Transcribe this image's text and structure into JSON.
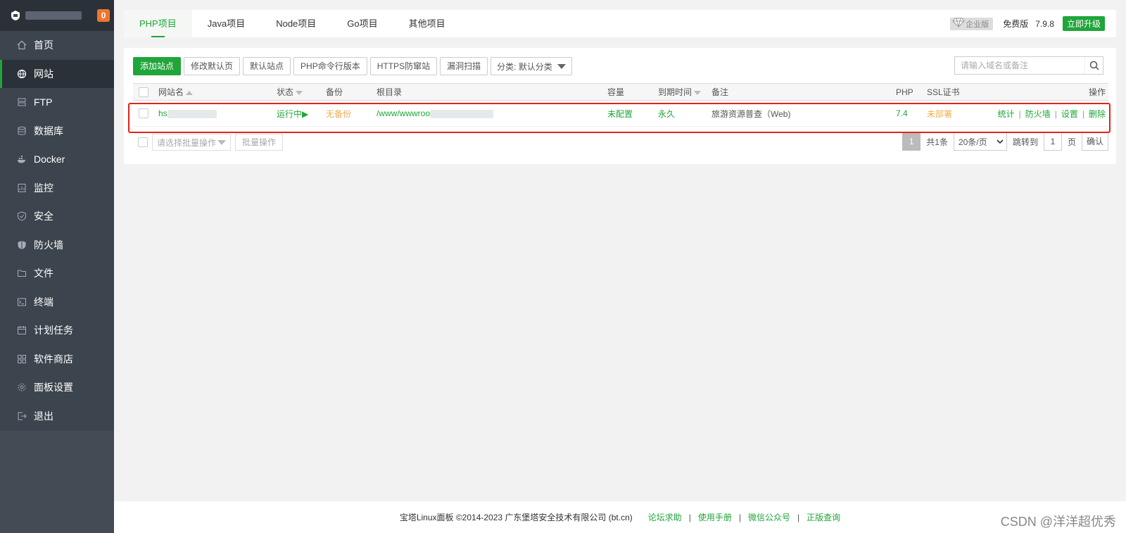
{
  "sidebar": {
    "badge": "0",
    "items": [
      {
        "label": "首页",
        "icon": "home-icon"
      },
      {
        "label": "网站",
        "icon": "globe-icon"
      },
      {
        "label": "FTP",
        "icon": "ftp-icon"
      },
      {
        "label": "数据库",
        "icon": "database-icon"
      },
      {
        "label": "Docker",
        "icon": "docker-icon"
      },
      {
        "label": "监控",
        "icon": "monitor-icon"
      },
      {
        "label": "安全",
        "icon": "shield-icon"
      },
      {
        "label": "防火墙",
        "icon": "firewall-icon"
      },
      {
        "label": "文件",
        "icon": "folder-icon"
      },
      {
        "label": "终端",
        "icon": "terminal-icon"
      },
      {
        "label": "计划任务",
        "icon": "calendar-icon"
      },
      {
        "label": "软件商店",
        "icon": "apps-icon"
      },
      {
        "label": "面板设置",
        "icon": "gear-icon"
      },
      {
        "label": "退出",
        "icon": "logout-icon"
      }
    ],
    "active_index": 1
  },
  "tabs": [
    "PHP项目",
    "Java项目",
    "Node项目",
    "Go项目",
    "其他项目"
  ],
  "header_right": {
    "enterprise": "企业版",
    "free": "免费版",
    "version": "7.9.8",
    "upgrade": "立即升级"
  },
  "toolbar": {
    "add_site": "添加站点",
    "modify_default": "修改默认页",
    "default_site": "默认站点",
    "php_cli": "PHP命令行版本",
    "https_guard": "HTTPS防窜站",
    "vuln_scan": "漏洞扫描",
    "category": "分类: 默认分类",
    "search_placeholder": "请输入域名或备注"
  },
  "table": {
    "headers": {
      "name": "网站名",
      "status": "状态",
      "backup": "备份",
      "root": "根目录",
      "capacity": "容量",
      "expire": "到期时间",
      "remark": "备注",
      "php": "PHP",
      "ssl": "SSL证书",
      "ops": "操作"
    },
    "rows": [
      {
        "name": "hs",
        "status": "运行中▶",
        "backup": "无备份",
        "root": "/www/wwwroo",
        "capacity": "未配置",
        "expire": "永久",
        "remark": "旅游资源普查（Web)",
        "php": "7.4",
        "ssl": "未部署",
        "ops": [
          "统计",
          "防火墙",
          "设置",
          "删除"
        ]
      }
    ]
  },
  "batch": {
    "placeholder": "请选择批量操作",
    "button": "批量操作"
  },
  "pager": {
    "current": "1",
    "total": "共1条",
    "page_size": "20条/页",
    "jump_label": "跳转到",
    "jump_value": "1",
    "page_unit": "页",
    "confirm": "确认"
  },
  "footer": {
    "copyright": "宝塔Linux面板 ©2014-2023 广东堡塔安全技术有限公司 (bt.cn)",
    "links": [
      "论坛求助",
      "使用手册",
      "微信公众号",
      "正版查询"
    ]
  },
  "watermark": "CSDN @洋洋超优秀",
  "colors": {
    "accent": "#20a53a",
    "warning": "#f0ad4e",
    "sidebar": "#3c444d",
    "highlight": "#e2231a"
  }
}
